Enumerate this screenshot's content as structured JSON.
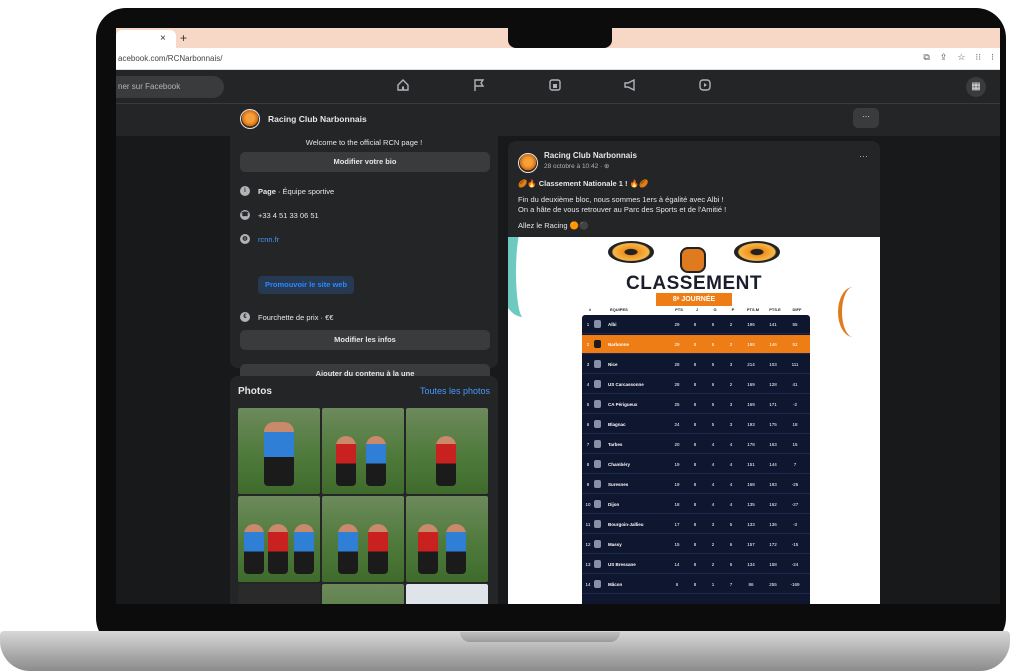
{
  "browser": {
    "tab_close": "×",
    "tab_new": "+",
    "url": "acebook.com/RCNarbonnais/",
    "url_icons": [
      "⧉",
      "⇪",
      "☆",
      "⁝⁝",
      "⁝"
    ]
  },
  "fb_nav": {
    "search_placeholder": "ner sur Facebook",
    "icons": [
      "home-icon",
      "flag-icon",
      "store-icon",
      "megaphone-icon",
      "video-icon"
    ],
    "grid_icon": "menu-grid-icon"
  },
  "page_header": {
    "name": "Racing Club Narbonnais",
    "more": "···"
  },
  "intro": {
    "bio": "Welcome to the official RCN page !",
    "edit_bio": "Modifier votre bio",
    "category_label": "Page",
    "category_value": " · Équipe sportive",
    "phone": "+33 4 51 33 06 51",
    "website": "rcnn.fr",
    "promote_website": "Promouvoir le site web",
    "price_range": "Fourchette de prix · €€",
    "edit_info": "Modifier les infos",
    "add_featured": "Ajouter du contenu à la une"
  },
  "photos": {
    "title": "Photos",
    "see_all": "Toutes les photos"
  },
  "post": {
    "author": "Racing Club Narbonnais",
    "date": "28 octobre à 10:42 · ⊕",
    "more": "···",
    "headline": "🏉🔥 Classement Nationale 1 ! 🔥🏉",
    "line1": "Fin du deuxième bloc, nous sommes 1ers à égalité avec Albi !",
    "line2": "On a hâte de vous retrouver au Parc des Sports et de l'Amitié !",
    "line3": "Allez le Racing 🟠⚫"
  },
  "graphic": {
    "title": "CLASSEMENT",
    "subtitle": "8ᵉ JOURNÉE",
    "columns": [
      "#",
      "EQUIPES",
      "PTS",
      "J",
      "G",
      "P",
      "PTS.M",
      "PTS.E",
      "DIFF"
    ],
    "rows": [
      {
        "rank": "1",
        "team": "Albi",
        "pts": "29",
        "j": "8",
        "g": "6",
        "p": "2",
        "pm": "196",
        "pe": "141",
        "diff": "55"
      },
      {
        "rank": "2",
        "team": "Narbonne",
        "pts": "29",
        "j": "8",
        "g": "6",
        "p": "2",
        "pm": "198",
        "pe": "146",
        "diff": "52"
      },
      {
        "rank": "3",
        "team": "Nice",
        "pts": "28",
        "j": "8",
        "g": "5",
        "p": "3",
        "pm": "214",
        "pe": "103",
        "diff": "111"
      },
      {
        "rank": "4",
        "team": "US Carcassonne",
        "pts": "28",
        "j": "8",
        "g": "6",
        "p": "2",
        "pm": "169",
        "pe": "128",
        "diff": "41"
      },
      {
        "rank": "5",
        "team": "CA Périgueux",
        "pts": "25",
        "j": "8",
        "g": "5",
        "p": "3",
        "pm": "169",
        "pe": "171",
        "diff": "-2"
      },
      {
        "rank": "6",
        "team": "Blagnac",
        "pts": "24",
        "j": "8",
        "g": "5",
        "p": "3",
        "pm": "193",
        "pe": "175",
        "diff": "18"
      },
      {
        "rank": "7",
        "team": "Tarbes",
        "pts": "20",
        "j": "8",
        "g": "4",
        "p": "4",
        "pm": "178",
        "pe": "163",
        "diff": "15"
      },
      {
        "rank": "8",
        "team": "Chambéry",
        "pts": "19",
        "j": "8",
        "g": "4",
        "p": "4",
        "pm": "151",
        "pe": "144",
        "diff": "7"
      },
      {
        "rank": "9",
        "team": "Suresnes",
        "pts": "19",
        "j": "8",
        "g": "4",
        "p": "4",
        "pm": "168",
        "pe": "193",
        "diff": "-25"
      },
      {
        "rank": "10",
        "team": "Dijon",
        "pts": "18",
        "j": "8",
        "g": "4",
        "p": "4",
        "pm": "135",
        "pe": "162",
        "diff": "-27"
      },
      {
        "rank": "11",
        "team": "Bourgoin-Jallieu",
        "pts": "17",
        "j": "8",
        "g": "3",
        "p": "5",
        "pm": "133",
        "pe": "136",
        "diff": "-3"
      },
      {
        "rank": "12",
        "team": "Massy",
        "pts": "15",
        "j": "8",
        "g": "2",
        "p": "6",
        "pm": "157",
        "pe": "172",
        "diff": "-15"
      },
      {
        "rank": "13",
        "team": "US Bressane",
        "pts": "14",
        "j": "8",
        "g": "2",
        "p": "6",
        "pm": "134",
        "pe": "158",
        "diff": "-24"
      },
      {
        "rank": "14",
        "team": "Mâcon",
        "pts": "6",
        "j": "8",
        "g": "1",
        "p": "7",
        "pm": "86",
        "pe": "255",
        "diff": "-169"
      }
    ]
  },
  "colors": {
    "fb_bg": "#18191a",
    "fb_card": "#242526",
    "accent_orange": "#ef7d16",
    "link_blue": "#4599ff",
    "table_navy": "#0f1630"
  }
}
